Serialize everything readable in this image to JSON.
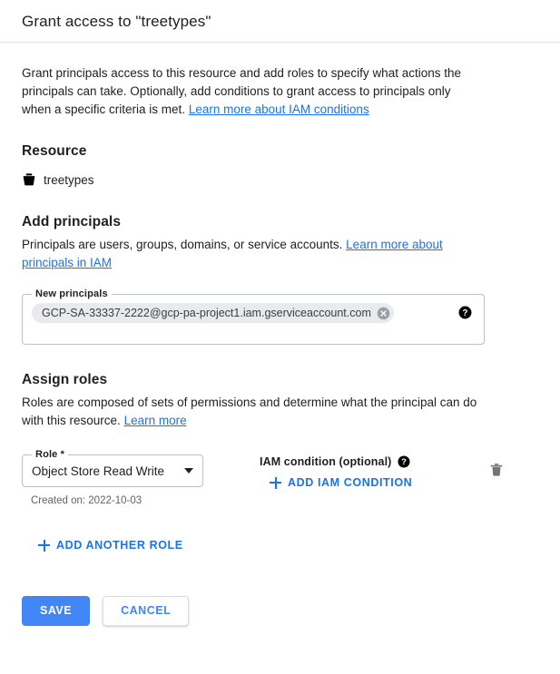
{
  "header": {
    "title": "Grant access to \"treetypes\""
  },
  "intro": {
    "text": "Grant principals access to this resource and add roles to specify what actions the principals can take. Optionally, add conditions to grant access to principals only when a specific criteria is met.",
    "link_label": "Learn more about IAM conditions"
  },
  "resource": {
    "heading": "Resource",
    "icon": "bucket-icon",
    "name": "treetypes"
  },
  "add_principals": {
    "heading": "Add principals",
    "description": "Principals are users, groups, domains, or service accounts.",
    "link_label": "Learn more about principals in IAM",
    "field_label": "New principals",
    "placeholder": "",
    "chips": [
      {
        "label": "GCP-SA-33337-2222@gcp-pa-project1.iam.gserviceaccount.com",
        "remove_icon": "close-circle-icon"
      }
    ],
    "help_icon": "help-icon"
  },
  "assign_roles": {
    "heading": "Assign roles",
    "description": "Roles are composed of sets of permissions and determine what the principal can do with this resource.",
    "link_label": "Learn more",
    "role_field_label": "Role *",
    "role_value": "Object Store Read Write",
    "role_options": [
      "Object Store Read Write"
    ],
    "dropdown_icon": "chevron-down-icon",
    "created_on": "Created on: 2022-10-03",
    "condition_label": "IAM condition (optional)",
    "condition_help_icon": "help-icon",
    "add_condition_label": "ADD IAM CONDITION",
    "add_condition_icon": "plus-icon",
    "delete_role_icon": "trash-icon",
    "add_another_role_label": "ADD ANOTHER ROLE",
    "add_another_role_icon": "plus-icon"
  },
  "footer": {
    "save_label": "SAVE",
    "cancel_label": "CANCEL"
  },
  "colors": {
    "link_blue": "#1a73e8",
    "action_blue": "#1a73e8",
    "primary_button": "#4285f4",
    "chip_background": "#e8eaed",
    "muted_text": "#5f6368",
    "border": "#bdc1c6"
  }
}
